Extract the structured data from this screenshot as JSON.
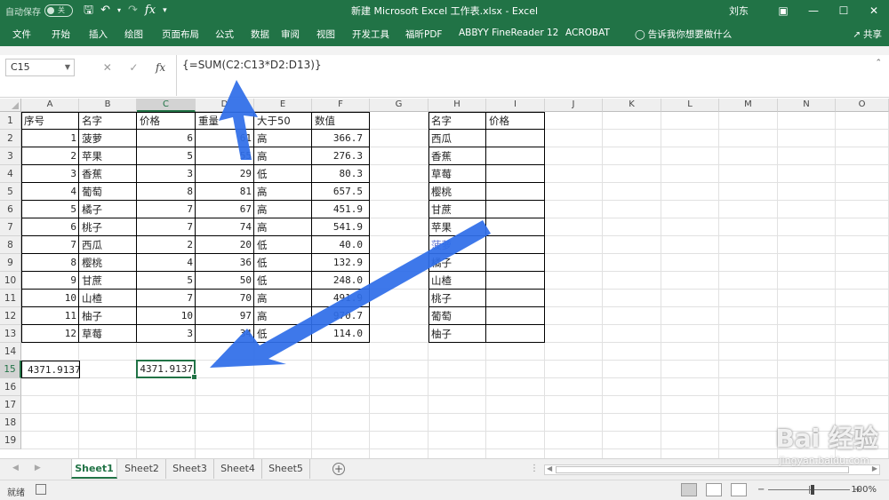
{
  "titlebar": {
    "autosave_label": "自动保存",
    "autosave_state": "关",
    "title": "新建 Microsoft Excel 工作表.xlsx  -  Excel",
    "user": "刘东",
    "colors": {
      "brand": "#217346"
    }
  },
  "ribbon": {
    "tabs": [
      "文件",
      "开始",
      "插入",
      "绘图",
      "页面布局",
      "公式",
      "数据",
      "审阅",
      "视图",
      "开发工具",
      "福昕PDF",
      "ABBYY FineReader 12",
      "ACROBAT"
    ],
    "tell_me": "告诉我你想要做什么",
    "share": "共享"
  },
  "formula_bar": {
    "name_box": "C15",
    "formula": "{=SUM(C2:C13*D2:D13)}"
  },
  "columns": [
    "A",
    "B",
    "C",
    "D",
    "E",
    "F",
    "G",
    "H",
    "I",
    "J",
    "K",
    "L",
    "M",
    "N",
    "O"
  ],
  "rows": [
    "1",
    "2",
    "3",
    "4",
    "5",
    "6",
    "7",
    "8",
    "9",
    "10",
    "11",
    "12",
    "13",
    "14",
    "15",
    "16",
    "17",
    "18",
    "19"
  ],
  "table1": {
    "headers": [
      "序号",
      "名字",
      "价格",
      "重量",
      "大于50",
      "数值"
    ],
    "rows": [
      [
        "1",
        "菠萝",
        "6",
        "61",
        "高",
        "366.7"
      ],
      [
        "2",
        "苹果",
        "5",
        "55",
        "高",
        "276.3"
      ],
      [
        "3",
        "香蕉",
        "3",
        "29",
        "低",
        "80.3"
      ],
      [
        "4",
        "葡萄",
        "8",
        "81",
        "高",
        "657.5"
      ],
      [
        "5",
        "橘子",
        "7",
        "67",
        "高",
        "451.9"
      ],
      [
        "6",
        "桃子",
        "7",
        "74",
        "高",
        "541.9"
      ],
      [
        "7",
        "西瓜",
        "2",
        "20",
        "低",
        "40.0"
      ],
      [
        "8",
        "樱桃",
        "4",
        "36",
        "低",
        "132.9"
      ],
      [
        "9",
        "甘蔗",
        "5",
        "50",
        "低",
        "248.0"
      ],
      [
        "10",
        "山楂",
        "7",
        "70",
        "高",
        "491.9"
      ],
      [
        "11",
        "柚子",
        "10",
        "97",
        "高",
        "970.7"
      ],
      [
        "12",
        "草莓",
        "3",
        "34",
        "低",
        "114.0"
      ]
    ]
  },
  "table2": {
    "headers": [
      "名字",
      "价格"
    ],
    "names": [
      "西瓜",
      "香蕉",
      "草莓",
      "樱桃",
      "甘蔗",
      "苹果",
      "菠萝",
      "橘子",
      "山楂",
      "桃子",
      "葡萄",
      "柚子"
    ]
  },
  "results": {
    "a15": "4371.9137",
    "c15": "4371.9137"
  },
  "sheets": [
    "Sheet1",
    "Sheet2",
    "Sheet3",
    "Sheet4",
    "Sheet5"
  ],
  "active_sheet": "Sheet1",
  "status": {
    "ready": "就绪",
    "zoom": "100%"
  },
  "watermark": {
    "main": "Bai 经验",
    "sub": "jingyan.baidu.com"
  }
}
